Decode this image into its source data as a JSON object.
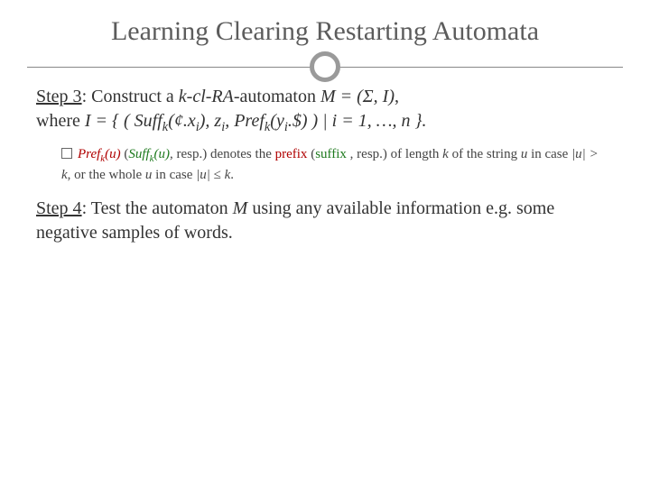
{
  "title": "Learning Clearing Restarting Automata",
  "step3": {
    "label": "Step 3",
    "lead": ": Construct a ",
    "kcl": "k-cl-RA",
    "mid1": "-automaton ",
    "M": "M = (Σ, I)",
    "comma": ",",
    "where": "where ",
    "Idef_open": "I = { ( Suff",
    "k1": "k",
    "suff_arg_open": "(¢.x",
    "i1": "i",
    "after_suff": "), z",
    "i2": "i",
    "sep": ", Pref",
    "k2": "k",
    "pref_arg_open": "(y",
    "i3": "i",
    "pref_arg_close": ".$) ) | i = 1, …, n }.",
    "sub": {
      "pref": "Pref",
      "k3": "k",
      "u1": "(u)",
      "open_paren": " (",
      "suff": "Suff",
      "k4": "k",
      "u2": "(u)",
      "resp1": ", resp.) denotes the ",
      "prefix": "prefix",
      "space_open": " (",
      "suffix": "suffix",
      "resp2": " , resp.) of length ",
      "k5": "k",
      "tail1": " of the string ",
      "u3": "u",
      "tail2": " in case ",
      "abs_u1": "|u|",
      "gt": " > ",
      "k6": "k",
      "tail3": ", or the whole ",
      "u4": "u",
      "tail4": " in case ",
      "abs_u2": "|u|",
      "le": " ≤ ",
      "k7": "k",
      "period": "."
    }
  },
  "step4": {
    "label": "Step 4",
    "lead": ": Test the automaton ",
    "M": "M",
    "tail": " using any available information e.g. some negative samples of words."
  }
}
